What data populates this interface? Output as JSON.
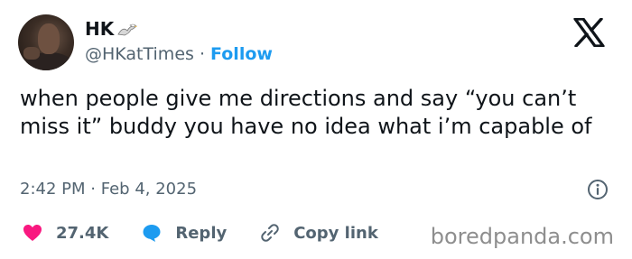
{
  "author": {
    "display_name": "HK",
    "handle": "@HKatTimes",
    "separator": "·",
    "follow_label": "Follow"
  },
  "tweet": {
    "text": "when people give me directions and say “you can’t miss it” buddy you have no idea what i’m capable of",
    "time": "2:42 PM",
    "date_separator": "·",
    "date": "Feb 4, 2025"
  },
  "actions": {
    "like_count": "27.4K",
    "reply_label": "Reply",
    "copy_link_label": "Copy link"
  },
  "watermark": "boredpanda.com",
  "colors": {
    "text": "#0f1419",
    "muted": "#536471",
    "accent": "#1d9bf0",
    "like": "#f91880"
  },
  "icons": [
    "eagle-emoji-icon",
    "x-logo-icon",
    "info-icon",
    "heart-icon",
    "reply-bubble-icon",
    "link-icon"
  ]
}
